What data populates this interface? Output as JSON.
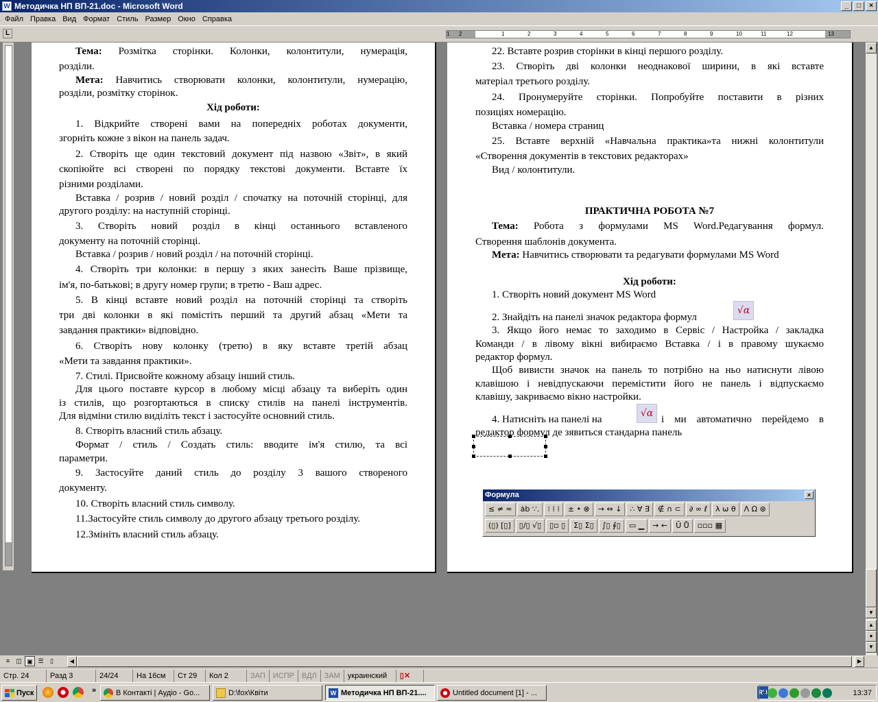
{
  "window": {
    "title": "Методичка НП ВП-21.doc - Microsoft Word",
    "icon": "word-icon",
    "controls": [
      "_",
      "□",
      "×"
    ]
  },
  "menu": [
    "Файл",
    "Правка",
    "Вид",
    "Формат",
    "Стиль",
    "Размер",
    "Окно",
    "Справка"
  ],
  "ruler": {
    "corner": "L",
    "ticks": [
      "1",
      "2",
      "1",
      "1",
      "2",
      "3",
      "4",
      "5",
      "6",
      "7",
      "8",
      "9",
      "10",
      "11",
      "12",
      "13"
    ]
  },
  "left_page": [
    {
      "type": "mixed",
      "bold": "Тема:",
      "text": " Розмітка сторінки. Колонки, колонтитули, нумерація,",
      "cont": "розділи."
    },
    {
      "type": "mixed",
      "bold": "Мета:",
      "text": " Навчитись створювати колонки, колонтитули, нумерацію,",
      "cont": "розділи, розмітку сторінок."
    },
    {
      "type": "heading",
      "text": "Хід роботи:"
    },
    {
      "type": "para",
      "first": "1.  Відкрийте створені вами на попередніх роботах документи,",
      "rest": [
        "згорніть кожне з вікон на панель задач."
      ]
    },
    {
      "type": "para",
      "first": "2.   Створіть ще один текстовий документ під назвою «Звіт», в який",
      "rest": [
        "скопіюйте всі створені по порядку текстові документи. Вставте їх",
        "різними розділами."
      ]
    },
    {
      "type": "para",
      "first": "Вставка / розрив / новий розділ / спочатку на поточній сторінці, для",
      "rest": [
        "другого розділу: на наступній сторінці."
      ]
    },
    {
      "type": "para",
      "first": "3.  Створіть новий розділ в кінці останнього вставленого",
      "rest": [
        "документу на поточній сторінці."
      ]
    },
    {
      "type": "para",
      "first": "Вставка / розрив / новий розділ / на поточній сторінці.",
      "rest": []
    },
    {
      "type": "para",
      "first": "4.   Створіть три колонки: в першу з яких занесіть Ваше прізвище,",
      "rest": [
        "ім'я, по-батькові; в другу номер групи; в третю - Ваш адрес."
      ]
    },
    {
      "type": "para",
      "first": "5.   В кінці вставте новий розділ на поточній сторінці та створіть",
      "rest": [
        "три дві колонки в які помістіть перший та другий абзац «Мети та",
        "завдання практики» відповідно."
      ]
    },
    {
      "type": "para",
      "first": "6.    Створіть нову колонку (третю) в яку вставте третій абзац",
      "rest": [
        "«Мети та завдання практики»."
      ]
    },
    {
      "type": "para",
      "first": "7.   Стилі. Присвойте кожному абзацу інший стиль.",
      "rest": []
    },
    {
      "type": "para",
      "first": "Для цього поставте курсор в любому місці абзацу та виберіть один",
      "rest": [
        "із стилів, що розгортаються в списку стилів на панелі інструментів.",
        "Для відміни стилю виділіть текст і застосуйте основний стиль."
      ]
    },
    {
      "type": "para",
      "first": "8.   Створіть власний стиль абзацу.",
      "rest": []
    },
    {
      "type": "para",
      "first": "Формат / стиль / Создать стиль: вводите ім'я стилю, та всі",
      "rest": [
        "параметри."
      ]
    },
    {
      "type": "para",
      "first": "9.   Застосуйте даний стиль до розділу 3 вашого створеного",
      "rest": [
        "документу."
      ]
    },
    {
      "type": "para",
      "first": "10. Створіть власний стиль символу.",
      "rest": []
    },
    {
      "type": "para",
      "first": "11.Застосуйте стиль символу до другого абзацу третього розділу.",
      "rest": []
    },
    {
      "type": "para",
      "first": "12.Змініть власний стиль абзацу.",
      "rest": []
    }
  ],
  "right_page": {
    "p22": "22. Вставте розрив сторінки в кінці першого розділу.",
    "p23a": "23. Створіть дві колонки неоднакової ширини, в які вставте",
    "p23b": "матеріал третього розділу.",
    "p24a": "24. Пронумеруйте сторінки. Попробуйте поставити в різних",
    "p24b": "позиціях номерацію.",
    "p24c": "Вставка / номера страниц",
    "p25a": "25. Вставте верхній «Навчальна практика»та нижні колонтитули",
    "p25b": "«Створення документів в текстових редакторах»",
    "p25c": "Вид / колонтитули.",
    "heading": "ПРАКТИЧНА РОБОТА №7",
    "tema_bold": "Тема:",
    "tema_text": " Робота з формулами MS Word.Редагування формул.",
    "tema_cont": "Створення шаблонів документа.",
    "meta_bold": "Мета:",
    "meta_text": " Навчитись створювати та редагувати формулами MS Word",
    "hid": "Хід роботи:",
    "s1": "1.   Створіть новий документ MS Word",
    "s2": "2.   Знайдіть на панелі значок редактора формул",
    "s3a": "3.   Якщо його немає то заходимо в Сервіс / Настройка / закладка",
    "s3b": "Команди / в лівому вікні вибираємо Вставка / і в правому шукаємо",
    "s3c": "редактор формул.",
    "s4a": "Щоб вивисти значок на панель то потрібно на ньо натиснути лівою",
    "s4b": "клавішою і невідпускаючи перемістити його не панель і відпускаємо",
    "s4c": "клавішу, закриваємо вікно настройки.",
    "s5a": "4.   Натисніть на панелі на",
    "s5b": "і ми автоматично перейдемо в",
    "s5c": "редактор формул де зявиться стандарна панель",
    "eq_icon": "√α"
  },
  "formula_toolbar": {
    "title": "Формула",
    "close": "×",
    "row1": [
      "≤ ≠ ≈",
      "ȧb ∵.",
      "⁝ ⁞ ⁞",
      "± • ⊗",
      "→ ⇔ ↓",
      "∴ ∀ ∃",
      "∉ ∩ ⊂",
      "∂ ∞ ℓ",
      "λ ω θ",
      "Λ Ω ⊛"
    ],
    "row2": [
      "(▯) [▯]",
      "▯/▯ √▯",
      "▯▫ ▯",
      "Σ▯ Σ▯",
      "∫▯ ∮▯",
      "▭ ▁",
      "→ ←",
      "Ū Ů",
      "▫▫▫ ▦"
    ]
  },
  "statusbar": {
    "page": "Стр. 24",
    "section": "Разд 3",
    "pages": "24/24",
    "at": "На 16см",
    "line": "Ст 29",
    "col": "Кол 2",
    "rec": "ЗАП",
    "trk": "ИСПР",
    "ext": "ВДЛ",
    "ovr": "ЗАМ",
    "lang": "украинский"
  },
  "taskbar": {
    "start": "Пуск",
    "tasks": [
      {
        "label": "В Контакті | Аудіо - Go...",
        "icon": "chrome-icon"
      },
      {
        "label": "D:\\fox\\Квіти",
        "icon": "folder-icon"
      },
      {
        "label": "Методичка НП ВП-21....",
        "icon": "word-icon",
        "active": true
      },
      {
        "label": "Untitled document [1] - ...",
        "icon": "opera-icon"
      }
    ],
    "lang": "RU",
    "clock": "13:37",
    "chevron": "»",
    "tray_chevron": "«"
  }
}
